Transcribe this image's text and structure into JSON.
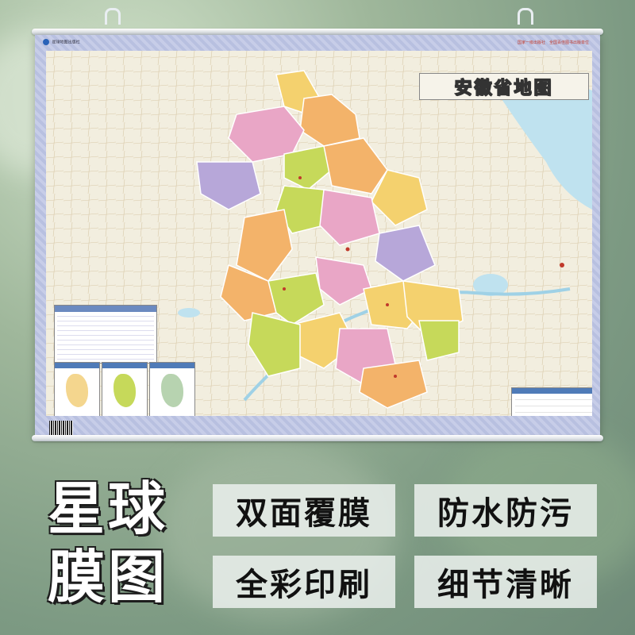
{
  "poster": {
    "title": "安徽省地图",
    "publisher": "星球地图出版社",
    "top_note": "国家一级出版社　全国百佳图书出版单位"
  },
  "brand": {
    "line1": "星球",
    "line2": "膜图"
  },
  "features": [
    {
      "label": "双面覆膜"
    },
    {
      "label": "防水防污"
    },
    {
      "label": "全彩印刷"
    },
    {
      "label": "细节清晰"
    }
  ],
  "colors": {
    "region_pink": "#e9a6c6",
    "region_yellow": "#f4d16e",
    "region_orange": "#f3b36a",
    "region_green": "#c6d95a",
    "region_purple": "#b7a7d9",
    "poster_border": "#c7cde8"
  }
}
